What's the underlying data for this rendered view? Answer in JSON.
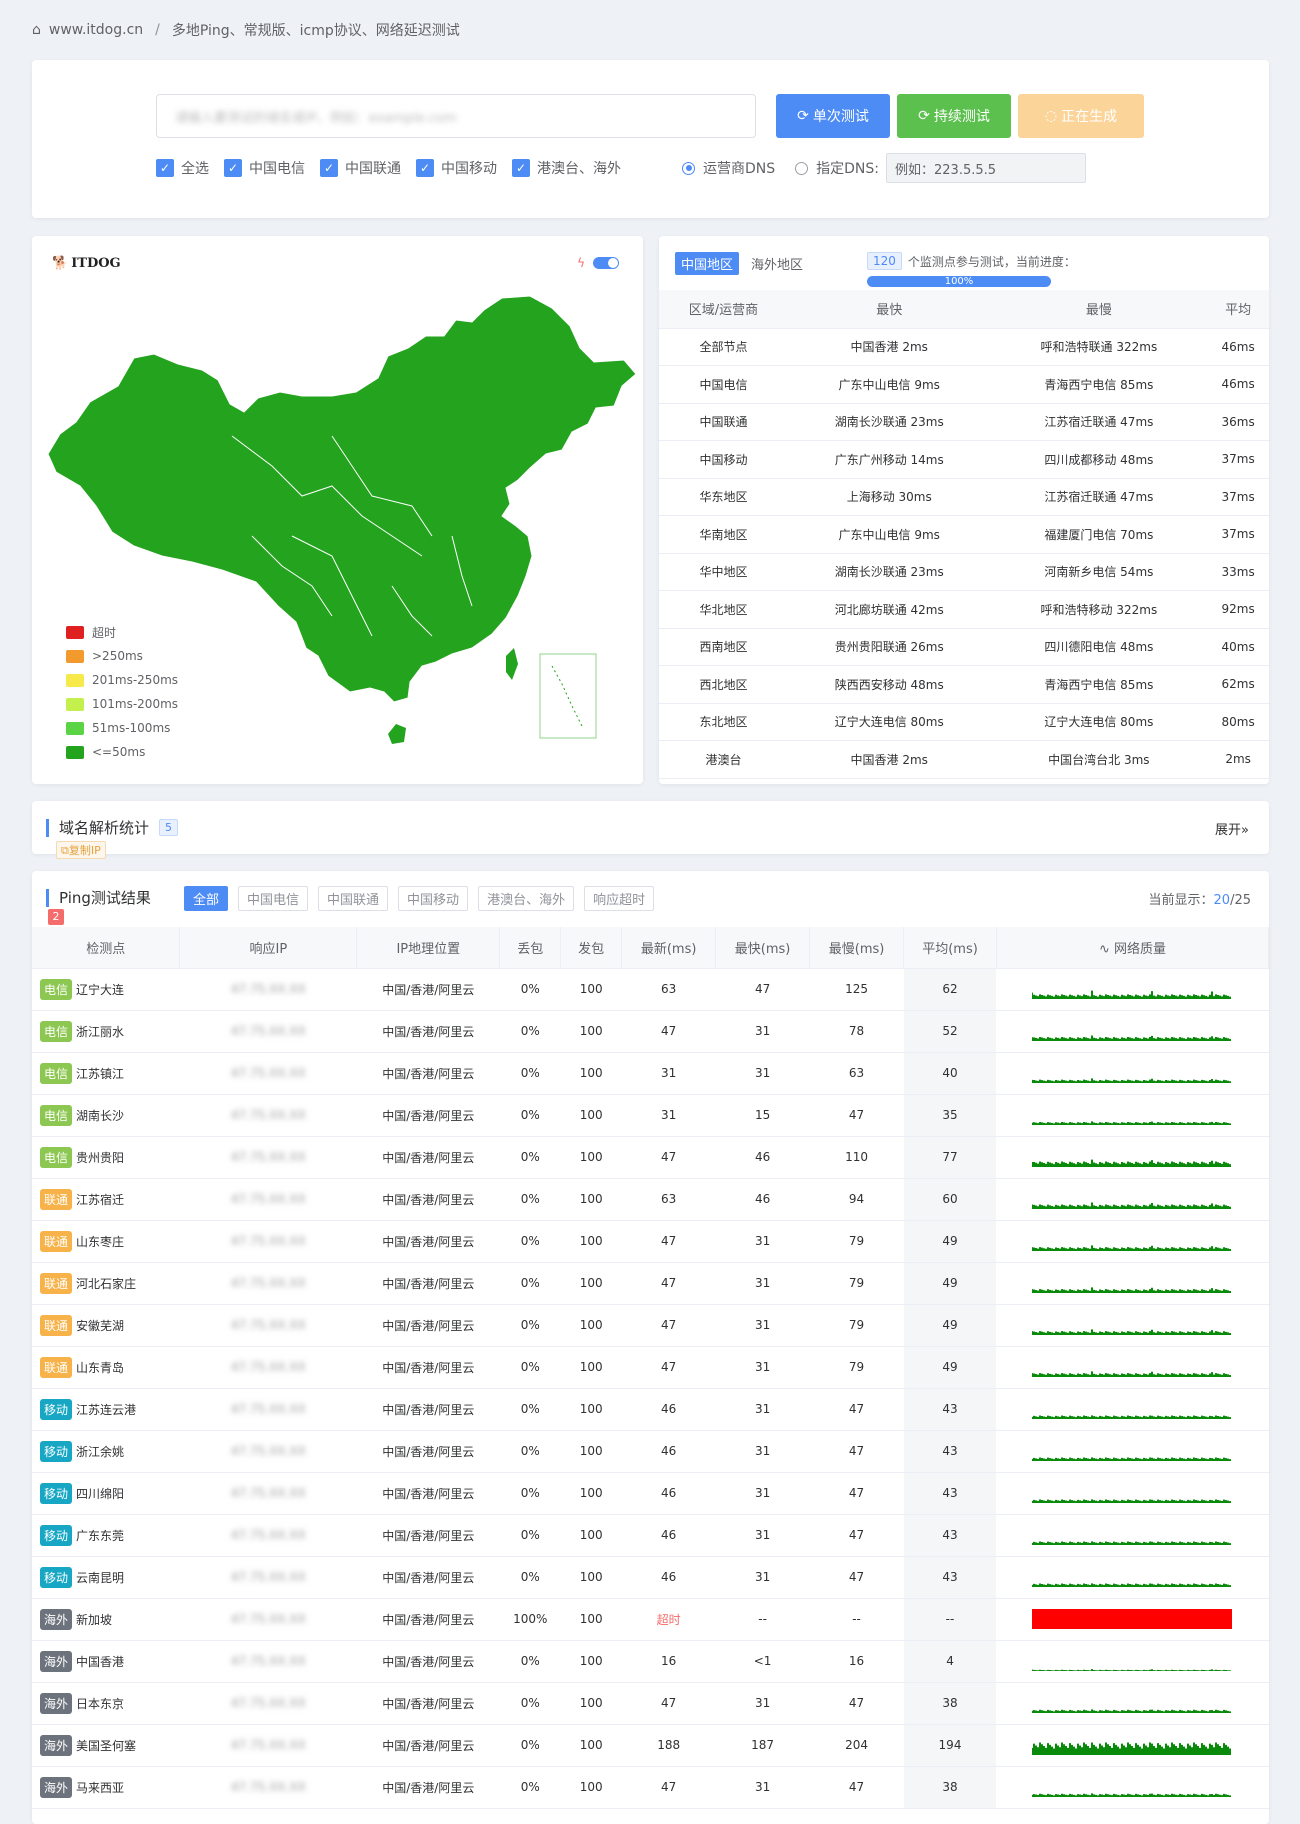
{
  "breadcrumb": {
    "site": "www.itdog.cn",
    "sep": "/",
    "page": "多地Ping、常规版、icmp协议、网络延迟测试"
  },
  "form": {
    "host_placeholder": "请输入要测试的域名或IP，例如：example.com",
    "btn_single": "单次测试",
    "btn_continuous": "持续测试",
    "btn_generating": "正在生成",
    "checks": [
      "全选",
      "中国电信",
      "中国联通",
      "中国移动",
      "港澳台、海外"
    ],
    "radio_isp": "运营商DNS",
    "radio_custom": "指定DNS:",
    "dns_placeholder": "例如：223.5.5.5"
  },
  "map": {
    "logo": "ITDOG",
    "legend": [
      {
        "label": "超时",
        "color": "#e02020"
      },
      {
        "label": ">250ms",
        "color": "#f29a2e"
      },
      {
        "label": "201ms-250ms",
        "color": "#f7e94a"
      },
      {
        "label": "101ms-200ms",
        "color": "#c3f04c"
      },
      {
        "label": "51ms-100ms",
        "color": "#5ad444"
      },
      {
        "label": "<=50ms",
        "color": "#23a31e"
      }
    ]
  },
  "summary": {
    "tabs": [
      "中国地区",
      "海外地区"
    ],
    "count": "120",
    "count_text": "个监测点参与测试，当前进度：",
    "progress": "100%",
    "headers": [
      "区域/运营商",
      "最快",
      "最慢",
      "平均"
    ],
    "rows": [
      [
        "全部节点",
        "中国香港 2ms",
        "呼和浩特联通 322ms",
        "46ms"
      ],
      [
        "中国电信",
        "广东中山电信 9ms",
        "青海西宁电信 85ms",
        "46ms"
      ],
      [
        "中国联通",
        "湖南长沙联通 23ms",
        "江苏宿迁联通 47ms",
        "36ms"
      ],
      [
        "中国移动",
        "广东广州移动 14ms",
        "四川成都移动 48ms",
        "37ms"
      ],
      [
        "华东地区",
        "上海移动 30ms",
        "江苏宿迁联通 47ms",
        "37ms"
      ],
      [
        "华南地区",
        "广东中山电信 9ms",
        "福建厦门电信 70ms",
        "37ms"
      ],
      [
        "华中地区",
        "湖南长沙联通 23ms",
        "河南新乡电信 54ms",
        "33ms"
      ],
      [
        "华北地区",
        "河北廊坊联通 42ms",
        "呼和浩特移动 322ms",
        "92ms"
      ],
      [
        "西南地区",
        "贵州贵阳联通 26ms",
        "四川德阳电信 48ms",
        "40ms"
      ],
      [
        "西北地区",
        "陕西西安移动 48ms",
        "青海西宁电信 85ms",
        "62ms"
      ],
      [
        "东北地区",
        "辽宁大连电信 80ms",
        "辽宁大连电信 80ms",
        "80ms"
      ],
      [
        "港澳台",
        "中国香港 2ms",
        "中国台湾台北 3ms",
        "2ms"
      ]
    ]
  },
  "dns": {
    "title": "域名解析统计",
    "count": "5",
    "copy": "复制IP",
    "expand": "展开"
  },
  "results": {
    "title": "Ping测试结果",
    "badge": "2",
    "filters": [
      "全部",
      "中国电信",
      "中国联通",
      "中国移动",
      "港澳台、海外",
      "响应超时"
    ],
    "display_label": "当前显示：",
    "display_cur": "20",
    "display_total": "/25",
    "headers": [
      "检测点",
      "响应IP",
      "IP地理位置",
      "丢包",
      "发包",
      "最新(ms)",
      "最快(ms)",
      "最慢(ms)",
      "平均(ms)",
      "网络质量"
    ],
    "isp_colors": {
      "电信": "#8cc751",
      "联通": "#f7b24a",
      "移动": "#17a6c4",
      "海外": "#6d737c"
    },
    "rows": [
      {
        "isp": "电信",
        "node": "辽宁大连",
        "ip": "47.75.XX.XX",
        "geo": "中国/香港/阿里云",
        "loss": "0%",
        "sent": "100",
        "last": "63",
        "fast": "47",
        "slow": "125",
        "avg": "62"
      },
      {
        "isp": "电信",
        "node": "浙江丽水",
        "ip": "47.75.XX.XX",
        "geo": "中国/香港/阿里云",
        "loss": "0%",
        "sent": "100",
        "last": "47",
        "fast": "31",
        "slow": "78",
        "avg": "52"
      },
      {
        "isp": "电信",
        "node": "江苏镇江",
        "ip": "47.75.XX.XX",
        "geo": "中国/香港/阿里云",
        "loss": "0%",
        "sent": "100",
        "last": "31",
        "fast": "31",
        "slow": "63",
        "avg": "40"
      },
      {
        "isp": "电信",
        "node": "湖南长沙",
        "ip": "47.75.XX.XX",
        "geo": "中国/香港/阿里云",
        "loss": "0%",
        "sent": "100",
        "last": "31",
        "fast": "15",
        "slow": "47",
        "avg": "35"
      },
      {
        "isp": "电信",
        "node": "贵州贵阳",
        "ip": "47.75.XX.XX",
        "geo": "中国/香港/阿里云",
        "loss": "0%",
        "sent": "100",
        "last": "47",
        "fast": "46",
        "slow": "110",
        "avg": "77"
      },
      {
        "isp": "联通",
        "node": "江苏宿迁",
        "ip": "47.75.XX.XX",
        "geo": "中国/香港/阿里云",
        "loss": "0%",
        "sent": "100",
        "last": "63",
        "fast": "46",
        "slow": "94",
        "avg": "60"
      },
      {
        "isp": "联通",
        "node": "山东枣庄",
        "ip": "47.75.XX.XX",
        "geo": "中国/香港/阿里云",
        "loss": "0%",
        "sent": "100",
        "last": "47",
        "fast": "31",
        "slow": "79",
        "avg": "49"
      },
      {
        "isp": "联通",
        "node": "河北石家庄",
        "ip": "47.75.XX.XX",
        "geo": "中国/香港/阿里云",
        "loss": "0%",
        "sent": "100",
        "last": "47",
        "fast": "31",
        "slow": "79",
        "avg": "49"
      },
      {
        "isp": "联通",
        "node": "安徽芜湖",
        "ip": "47.75.XX.XX",
        "geo": "中国/香港/阿里云",
        "loss": "0%",
        "sent": "100",
        "last": "47",
        "fast": "31",
        "slow": "79",
        "avg": "49"
      },
      {
        "isp": "联通",
        "node": "山东青岛",
        "ip": "47.75.XX.XX",
        "geo": "中国/香港/阿里云",
        "loss": "0%",
        "sent": "100",
        "last": "47",
        "fast": "31",
        "slow": "79",
        "avg": "49"
      },
      {
        "isp": "移动",
        "node": "江苏连云港",
        "ip": "47.75.XX.XX",
        "geo": "中国/香港/阿里云",
        "loss": "0%",
        "sent": "100",
        "last": "46",
        "fast": "31",
        "slow": "47",
        "avg": "43"
      },
      {
        "isp": "移动",
        "node": "浙江余姚",
        "ip": "47.75.XX.XX",
        "geo": "中国/香港/阿里云",
        "loss": "0%",
        "sent": "100",
        "last": "46",
        "fast": "31",
        "slow": "47",
        "avg": "43"
      },
      {
        "isp": "移动",
        "node": "四川绵阳",
        "ip": "47.75.XX.XX",
        "geo": "中国/香港/阿里云",
        "loss": "0%",
        "sent": "100",
        "last": "46",
        "fast": "31",
        "slow": "47",
        "avg": "43"
      },
      {
        "isp": "移动",
        "node": "广东东莞",
        "ip": "47.75.XX.XX",
        "geo": "中国/香港/阿里云",
        "loss": "0%",
        "sent": "100",
        "last": "46",
        "fast": "31",
        "slow": "47",
        "avg": "43"
      },
      {
        "isp": "移动",
        "node": "云南昆明",
        "ip": "47.75.XX.XX",
        "geo": "中国/香港/阿里云",
        "loss": "0%",
        "sent": "100",
        "last": "46",
        "fast": "31",
        "slow": "47",
        "avg": "43"
      },
      {
        "isp": "海外",
        "node": "新加坡",
        "ip": "47.75.XX.XX",
        "geo": "中国/香港/阿里云",
        "loss": "100%",
        "sent": "100",
        "last": "超时",
        "fast": "--",
        "slow": "--",
        "avg": "--"
      },
      {
        "isp": "海外",
        "node": "中国香港",
        "ip": "47.75.XX.XX",
        "geo": "中国/香港/阿里云",
        "loss": "0%",
        "sent": "100",
        "last": "16",
        "fast": "<1",
        "slow": "16",
        "avg": "4"
      },
      {
        "isp": "海外",
        "node": "日本东京",
        "ip": "47.75.XX.XX",
        "geo": "中国/香港/阿里云",
        "loss": "0%",
        "sent": "100",
        "last": "47",
        "fast": "31",
        "slow": "47",
        "avg": "38"
      },
      {
        "isp": "海外",
        "node": "美国圣何塞",
        "ip": "47.75.XX.XX",
        "geo": "中国/香港/阿里云",
        "loss": "0%",
        "sent": "100",
        "last": "188",
        "fast": "187",
        "slow": "204",
        "avg": "194"
      },
      {
        "isp": "海外",
        "node": "马来西亚",
        "ip": "47.75.XX.XX",
        "geo": "中国/香港/阿里云",
        "loss": "0%",
        "sent": "100",
        "last": "47",
        "fast": "31",
        "slow": "47",
        "avg": "38"
      }
    ]
  }
}
